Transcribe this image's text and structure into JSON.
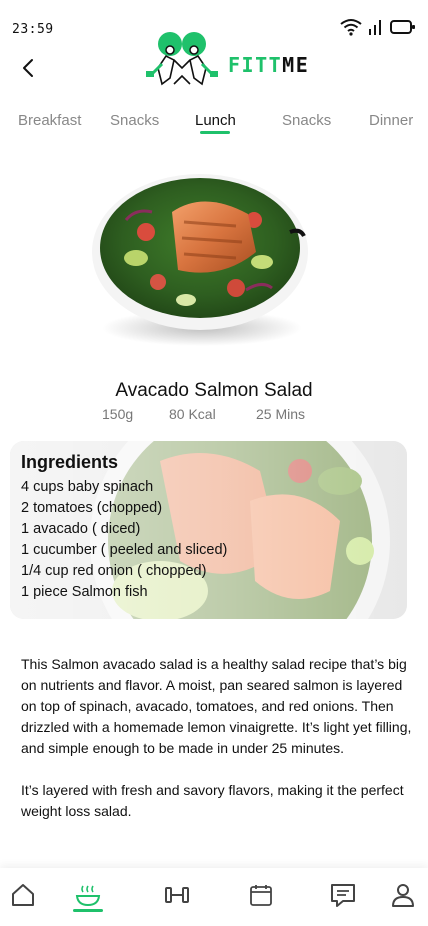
{
  "status": {
    "time": "23:59"
  },
  "brand": {
    "prefix": "FITT",
    "suffix": "ME"
  },
  "tabs": [
    {
      "label": "Breakfast",
      "active": false
    },
    {
      "label": "Snacks",
      "active": false
    },
    {
      "label": "Lunch",
      "active": true
    },
    {
      "label": "Snacks",
      "active": false
    },
    {
      "label": "Dinner",
      "active": false
    }
  ],
  "dish": {
    "title": "Avacado Salmon Salad",
    "weight": "150g",
    "calories": "80 Kcal",
    "time": "25 Mins"
  },
  "ingredients": {
    "title": "Ingredients",
    "items": [
      "4 cups baby spinach",
      "2 tomatoes (chopped)",
      "1 avacado ( diced)",
      "1 cucumber ( peeled and sliced)",
      "1/4 cup red onion ( chopped)",
      "1 piece Salmon fish"
    ]
  },
  "description": {
    "paragraphs": [
      "This Salmon avacado salad is a healthy salad recipe that’s big on nutrients and flavor. A moist, pan seared salmon is layered on top of spinach, avacado, tomatoes, and red onions. Then drizzled with a homemade lemon vinaigrette. It’s light yet filling, and simple enough to be made in under 25 minutes.",
      "It’s layered with fresh and savory flavors, making it the perfect weight loss salad."
    ]
  },
  "bottom_nav": {
    "items": [
      {
        "icon": "home-icon",
        "active": false
      },
      {
        "icon": "meal-bowl-icon",
        "active": true
      },
      {
        "icon": "dumbbell-icon",
        "active": false
      },
      {
        "icon": "calendar-icon",
        "active": false
      },
      {
        "icon": "chat-icon",
        "active": false
      },
      {
        "icon": "profile-icon",
        "active": false
      }
    ]
  },
  "colors": {
    "accent": "#1fc16b",
    "text": "#111111",
    "muted": "#888888"
  }
}
